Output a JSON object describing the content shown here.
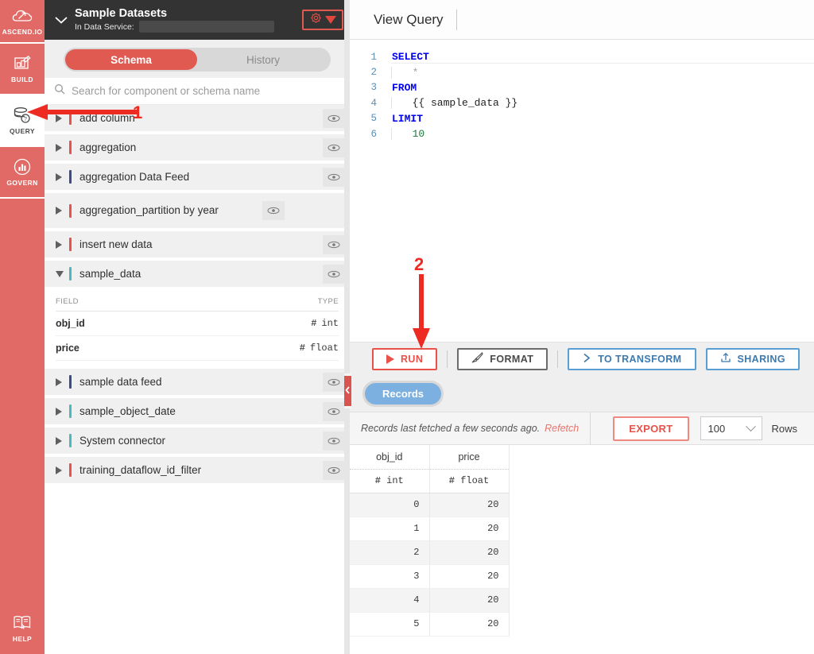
{
  "rail": {
    "logo_label": "ASCEND.IO",
    "items": [
      {
        "label": "BUILD",
        "icon": "build-icon",
        "active": false
      },
      {
        "label": "QUERY",
        "icon": "database-query-icon",
        "active": true
      },
      {
        "label": "GOVERN",
        "icon": "govern-chart-icon",
        "active": false
      }
    ],
    "help_label": "HELP"
  },
  "left_panel": {
    "header": {
      "title": "Sample Datasets",
      "subtitle": "In Data Service:",
      "data_service_value": "",
      "collapse_icon": "chevron-down-icon",
      "settings_icon": "gear-icon",
      "dropdown_icon": "caret-down-icon"
    },
    "tabs": [
      {
        "label": "Schema",
        "active": true
      },
      {
        "label": "History",
        "active": false
      }
    ],
    "search": {
      "placeholder": "Search for component or schema name",
      "value": "",
      "icon": "search-icon"
    },
    "schema_items": [
      {
        "name": "add column",
        "color": "#e8524a",
        "expanded": false
      },
      {
        "name": "aggregation",
        "color": "#e8524a",
        "expanded": false
      },
      {
        "name": "aggregation Data Feed",
        "color": "#3b4a8c",
        "expanded": false
      },
      {
        "name": "aggregation_partition by year",
        "color": "#e8524a",
        "expanded": false
      },
      {
        "name": "insert new data",
        "color": "#e8524a",
        "expanded": false
      },
      {
        "name": "sample_data",
        "color": "#4bb8bd",
        "expanded": true
      },
      {
        "name": "sample data feed",
        "color": "#3b4a8c",
        "expanded": false
      },
      {
        "name": "sample_object_date",
        "color": "#4bb8bd",
        "expanded": false
      },
      {
        "name": "System connector",
        "color": "#4bb8bd",
        "expanded": false
      },
      {
        "name": "training_dataflow_id_filter",
        "color": "#e8524a",
        "expanded": false
      }
    ],
    "field_table": {
      "header_field": "FIELD",
      "header_type": "TYPE",
      "rows": [
        {
          "field": "obj_id",
          "type": "int",
          "type_symbol": "#"
        },
        {
          "field": "price",
          "type": "float",
          "type_symbol": "#"
        }
      ]
    },
    "eye_icon": "eye-icon",
    "divider_handle_icon": "chevron-left-icon"
  },
  "right_panel": {
    "title": "View Query",
    "code_lines": [
      {
        "num": "1",
        "tokens": [
          {
            "t": "SELECT",
            "c": "kw"
          }
        ]
      },
      {
        "num": "2",
        "tokens": [
          {
            "t": "  *",
            "c": "star"
          }
        ]
      },
      {
        "num": "3",
        "tokens": [
          {
            "t": "FROM",
            "c": "kw"
          }
        ]
      },
      {
        "num": "4",
        "tokens": [
          {
            "t": "  {{ sample_data }}",
            "c": "plain"
          }
        ]
      },
      {
        "num": "5",
        "tokens": [
          {
            "t": "LIMIT",
            "c": "kw"
          }
        ]
      },
      {
        "num": "6",
        "tokens": [
          {
            "t": "  10",
            "c": "num"
          }
        ]
      }
    ],
    "toolbar": [
      {
        "label": "RUN",
        "icon": "play-icon",
        "style": "run"
      },
      {
        "label": "FORMAT",
        "icon": "brush-icon",
        "style": "format"
      },
      {
        "label": "TO TRANSFORM",
        "icon": "chevron-right-icon",
        "style": "transform"
      },
      {
        "label": "SHARING",
        "icon": "share-upload-icon",
        "style": "sharing"
      }
    ],
    "results_tabs": [
      {
        "label": "Records",
        "active": true
      }
    ],
    "fetch_bar": {
      "status": "Records last fetched a few seconds ago.",
      "refetch_label": "Refetch",
      "export_label": "EXPORT",
      "rows_value": "100",
      "rows_label": "Rows",
      "rows_dropdown_icon": "chevron-down-icon"
    },
    "results_table": {
      "columns": [
        {
          "name": "obj_id",
          "type": "int",
          "type_symbol": "#"
        },
        {
          "name": "price",
          "type": "float",
          "type_symbol": "#"
        }
      ],
      "rows": [
        [
          "0",
          "20"
        ],
        [
          "1",
          "20"
        ],
        [
          "2",
          "20"
        ],
        [
          "3",
          "20"
        ],
        [
          "4",
          "20"
        ],
        [
          "5",
          "20"
        ]
      ]
    }
  },
  "annotations": [
    {
      "number": "1",
      "direction": "left",
      "target": "query-rail-item"
    },
    {
      "number": "2",
      "direction": "down",
      "target": "run-button"
    }
  ],
  "colors": {
    "brand_red": "#e16a66",
    "accent_red": "#e8524a",
    "blue": "#5a9fd4",
    "teal": "#4bb8bd",
    "navy": "#3b4a8c",
    "annotation_red": "#ee2b22",
    "header_dark": "#333333"
  }
}
